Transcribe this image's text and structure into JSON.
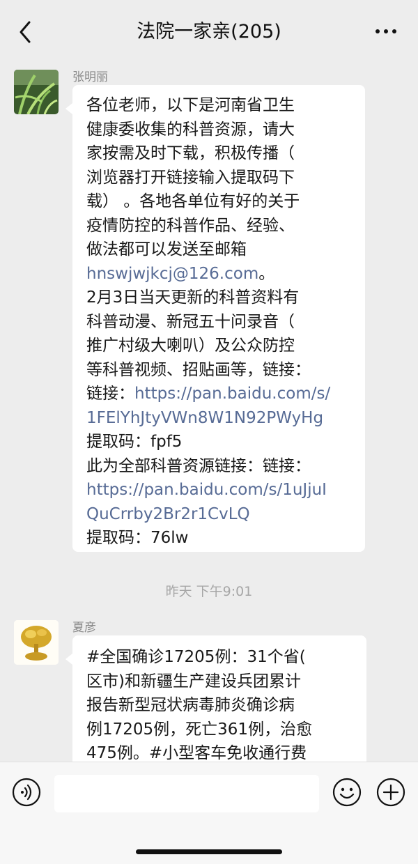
{
  "header": {
    "title": "法院一家亲(205)"
  },
  "messages": [
    {
      "sender": "张明丽",
      "lines": [
        {
          "text": "各位老师，以下是河南省卫生",
          "link": false
        },
        {
          "text": "健康委收集的科普资源，请大",
          "link": false
        },
        {
          "text": "家按需及时下载，积极传播（",
          "link": false
        },
        {
          "text": "浏览器打开链接输入提取码下",
          "link": false
        },
        {
          "text": "载）  。各地各单位有好的关于",
          "link": false
        },
        {
          "text": "疫情防控的科普作品、经验、",
          "link": false
        },
        {
          "text": "做法都可以发送至邮箱",
          "link": false
        },
        {
          "text": "hnswjwjkcj@126.com",
          "link": true,
          "suffix": "。"
        },
        {
          "text": "2月3日当天更新的科普资料有",
          "link": false
        },
        {
          "text": "科普动漫、新冠五十问录音（",
          "link": false
        },
        {
          "text": "推广村级大喇叭）及公众防控",
          "link": false
        },
        {
          "text": "等科普视频、招贴画等，链接：",
          "link": false
        },
        {
          "text": "链接：",
          "link": false,
          "linktext": "https://pan.baidu.com/s/"
        },
        {
          "text": "1FElYhJtyVWn8W1N92PWyHg",
          "link": true
        },
        {
          "text": "提取码：fpf5",
          "link": false
        },
        {
          "text": "此为全部科普资源链接：链接：",
          "link": false
        },
        {
          "text": "https://pan.baidu.com/s/1uJjuI",
          "link": true
        },
        {
          "text": "QuCrrby2Br2r1CvLQ",
          "link": true
        },
        {
          "text": "提取码：76lw",
          "link": false
        }
      ]
    },
    {
      "sender": "夏彦",
      "lines": [
        {
          "text": "#全国确诊17205例：31个省(",
          "link": false
        },
        {
          "text": "区市)和新疆生产建设兵团累计",
          "link": false
        },
        {
          "text": "报告新型冠状病毒肺炎确诊病",
          "link": false
        },
        {
          "text": "例17205例，死亡361例，治愈",
          "link": false
        },
        {
          "text": "475例。#小型客车免收通行费",
          "link": false
        }
      ]
    }
  ],
  "timestamp": "昨天 下午9:01",
  "input": {
    "value": ""
  },
  "icons": {
    "back": "back-chevron-icon",
    "more": "more-dots-icon",
    "voice": "voice-icon",
    "emoji": "emoji-icon",
    "plus": "plus-icon"
  }
}
